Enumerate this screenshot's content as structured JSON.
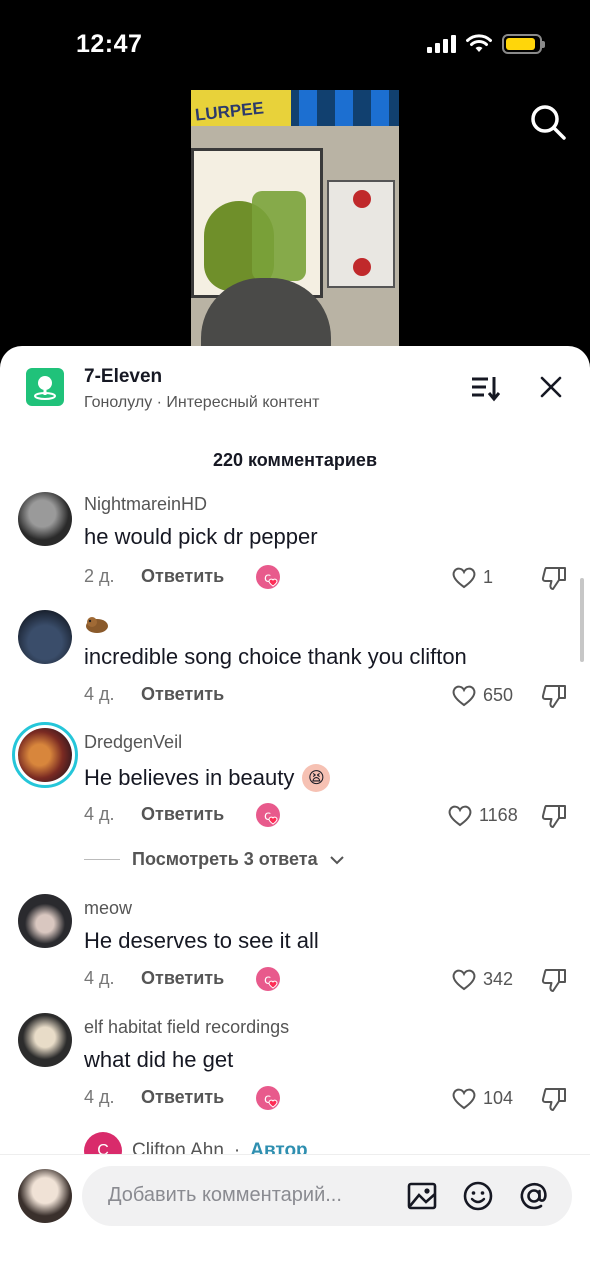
{
  "status_bar": {
    "time": "12:47",
    "battery_level": 0.9
  },
  "video": {
    "sign_text": "LURPEE"
  },
  "place": {
    "name": "7-Eleven",
    "subtitle": "Гонолулу · Интересный контент"
  },
  "comments_header": {
    "count_label": "220 комментариев"
  },
  "reply_label": "Ответить",
  "comments": [
    {
      "username": "NightmareinHD",
      "text": "he would pick dr pepper",
      "age": "2 д.",
      "likes": "1",
      "creator_liked": true,
      "emoji": ""
    },
    {
      "username": "",
      "text": "incredible song choice thank you clifton",
      "age": "4 д.",
      "likes": "650",
      "creator_liked": false,
      "emoji": ""
    },
    {
      "username": "DredgenVeil",
      "text": "He believes in beauty",
      "age": "4 д.",
      "likes": "1168",
      "creator_liked": true,
      "emoji": "😫"
    },
    {
      "username": "meow",
      "text": "He deserves to see it all",
      "age": "4 д.",
      "likes": "342",
      "creator_liked": true,
      "emoji": ""
    },
    {
      "username": "elf habitat field recordings",
      "text": "what did he get",
      "age": "4 д.",
      "likes": "104",
      "creator_liked": true,
      "emoji": ""
    }
  ],
  "view_replies": {
    "label": "Посмотреть 3 ответа"
  },
  "author_reply": {
    "name": "Clifton Ahn",
    "tag": "Автор",
    "separator": "·",
    "initial": "C"
  },
  "input": {
    "placeholder": "Добавить комментарий..."
  },
  "colors": {
    "accent_pink": "#fe2c55",
    "place_green": "#20c27a",
    "author_teal": "#2f8fb0"
  }
}
